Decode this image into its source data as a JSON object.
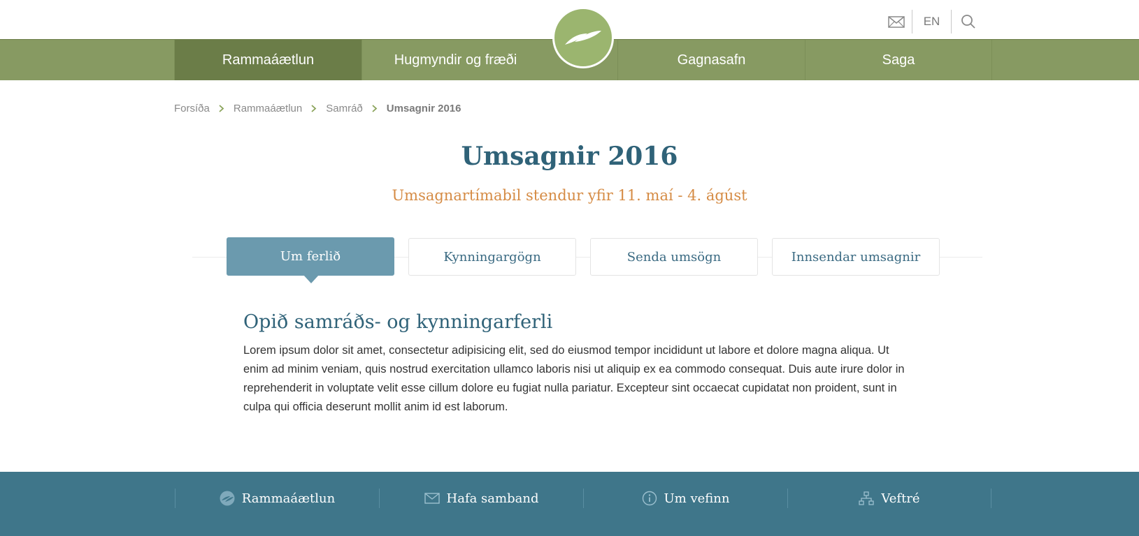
{
  "header": {
    "lang_label": "EN",
    "icons": [
      "mail-icon",
      "search-icon"
    ],
    "logo": "leaf-logo"
  },
  "nav": {
    "items": [
      {
        "label": "Rammaáætlun",
        "active": true
      },
      {
        "label": "Hugmyndir og fræði"
      },
      {
        "label": "Gagnasafn"
      },
      {
        "label": "Saga"
      }
    ]
  },
  "breadcrumb": [
    "Forsíða",
    "Rammaáætlun",
    "Samráð",
    "Umsagnir 2016"
  ],
  "page": {
    "title": "Umsagnir 2016",
    "subtitle": "Umsagnartímabil stendur yfir 11. maí - 4. ágúst"
  },
  "tabs": [
    {
      "label": "Um ferlið",
      "active": true
    },
    {
      "label": "Kynningargögn"
    },
    {
      "label": "Senda umsögn"
    },
    {
      "label": "Innsendar umsagnir"
    }
  ],
  "content": {
    "heading": "Opið samráðs- og kynningarferli",
    "body": "Lorem ipsum dolor sit amet, consectetur adipisicing elit, sed do eiusmod tempor incididunt ut labore et dolore magna aliqua. Ut enim ad minim veniam, quis nostrud exercitation ullamco laboris nisi ut aliquip ex ea commodo consequat. Duis aute irure dolor in reprehenderit in voluptate velit esse cillum dolore eu fugiat nulla pariatur. Excepteur sint occaecat cupidatat non proident, sunt in culpa qui officia deserunt mollit anim id est laborum."
  },
  "footer": {
    "items": [
      {
        "label": "Rammaáætlun",
        "icon": "leaf-logo-icon"
      },
      {
        "label": "Hafa samband",
        "icon": "mail-icon"
      },
      {
        "label": "Um vefinn",
        "icon": "info-icon"
      },
      {
        "label": "Veftré",
        "icon": "sitemap-icon"
      }
    ]
  },
  "colors": {
    "nav": "#879a62",
    "nav_active": "#6b7d48",
    "title": "#2f6278",
    "subtitle": "#d58b44",
    "tab_active": "#6b9aae",
    "footer": "#3f768a"
  }
}
